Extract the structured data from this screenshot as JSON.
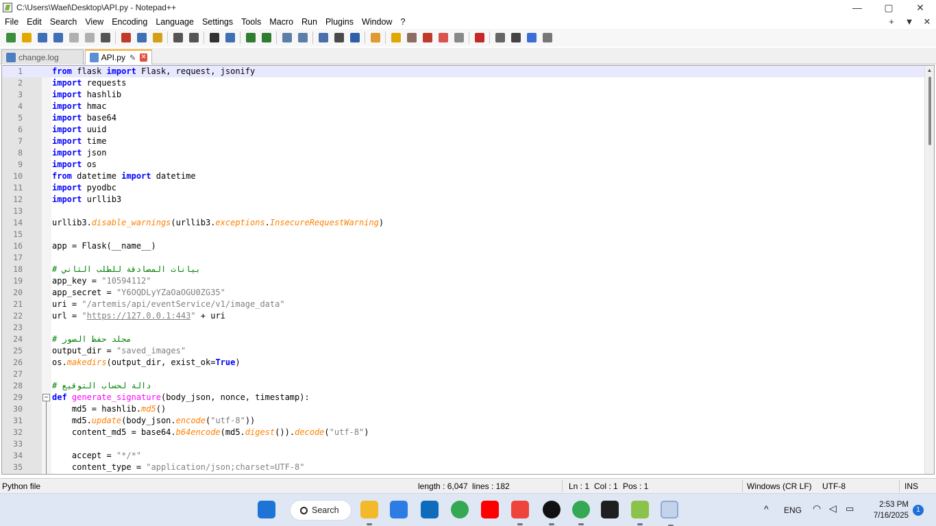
{
  "window": {
    "title": "C:\\Users\\Wael\\Desktop\\API.py - Notepad++",
    "controls": [
      "—",
      "▢",
      "✕"
    ]
  },
  "menu": {
    "items": [
      "File",
      "Edit",
      "Search",
      "View",
      "Encoding",
      "Language",
      "Settings",
      "Tools",
      "Macro",
      "Run",
      "Plugins",
      "Window",
      "?"
    ],
    "right_controls": [
      "+",
      "▼",
      "✕"
    ]
  },
  "toolbar": {
    "icons": [
      "new-file-icon",
      "open-file-icon",
      "save-icon",
      "save-all-icon",
      "close-icon",
      "close-all-icon",
      "print-icon",
      "cut-icon",
      "copy-icon",
      "paste-icon",
      "undo-icon",
      "redo-icon",
      "find-icon",
      "replace-icon",
      "zoom-in-icon",
      "zoom-out-icon",
      "sync-vertical-icon",
      "sync-horizontal-icon",
      "word-wrap-icon",
      "show-all-chars-icon",
      "indent-guide-icon",
      "function-list-icon",
      "folder-workspace-icon",
      "document-map-icon",
      "document-list-icon",
      "monitoring-icon",
      "doc-switcher-icon",
      "record-macro-icon",
      "stop-macro-icon",
      "play-macro-icon",
      "run-macro-multiple-icon",
      "save-macro-icon"
    ]
  },
  "tabs": [
    {
      "label": "change.log",
      "active": false
    },
    {
      "label": "API.py",
      "active": true
    }
  ],
  "editor": {
    "line_numbers": [
      "1",
      "2",
      "3",
      "4",
      "5",
      "6",
      "7",
      "8",
      "9",
      "10",
      "11",
      "12",
      "13",
      "14",
      "15",
      "16",
      "17",
      "18",
      "19",
      "20",
      "21",
      "22",
      "23",
      "24",
      "25",
      "26",
      "27",
      "28",
      "29",
      "30",
      "31",
      "32",
      "33",
      "34",
      "35"
    ],
    "lines": [
      "from flask import Flask, request, jsonify",
      "import requests",
      "import hashlib",
      "import hmac",
      "import base64",
      "import uuid",
      "import time",
      "import json",
      "import os",
      "from datetime import datetime",
      "import pyodbc",
      "import urllib3",
      "",
      "urllib3.disable_warnings(urllib3.exceptions.InsecureRequestWarning)",
      "",
      "app = Flask(__name__)",
      "",
      "# بيانات المصادقة للطلب الثاني",
      "app_key = \"10594112\"",
      "app_secret = \"Y6OQDLyYZaOaOGU0ZG35\"",
      "uri = \"/artemis/api/eventService/v1/image_data\"",
      "url = \"https://127.0.0.1:443\" + uri",
      "",
      "# مجلد حفظ الصور",
      "output_dir = \"saved_images\"",
      "os.makedirs(output_dir, exist_ok=True)",
      "",
      "# دالة لحساب التوقيع",
      "def generate_signature(body_json, nonce, timestamp):",
      "    md5 = hashlib.md5()",
      "    md5.update(body_json.encode(\"utf-8\"))",
      "    content_md5 = base64.b64encode(md5.digest()).decode(\"utf-8\")",
      "",
      "    accept = \"*/*\"",
      "    content_type = \"application/json;charset=UTF-8\""
    ]
  },
  "status": {
    "file_type": "Python file",
    "length": "length : 6,047",
    "lines": "lines : 182",
    "ln": "Ln : 1",
    "col": "Col : 1",
    "pos": "Pos : 1",
    "eol": "Windows (CR LF)",
    "encoding": "UTF-8",
    "mode": "INS"
  },
  "taskbar": {
    "search_label": "Search",
    "language": "ENG",
    "time": "2:53 PM",
    "date": "7/16/2025",
    "notification_count": "1",
    "colors": {
      "windows": "#1e73d6",
      "explorer": "#f2b92b",
      "store": "#2d7be5",
      "outlook": "#0f6cbd",
      "chrome": "#34a853",
      "youtube": "#ff0000",
      "anydesk": "#ef443b",
      "chatgpt": "#111111",
      "terminal": "#1f1f1f",
      "notepadpp": "#8bc34a"
    }
  }
}
